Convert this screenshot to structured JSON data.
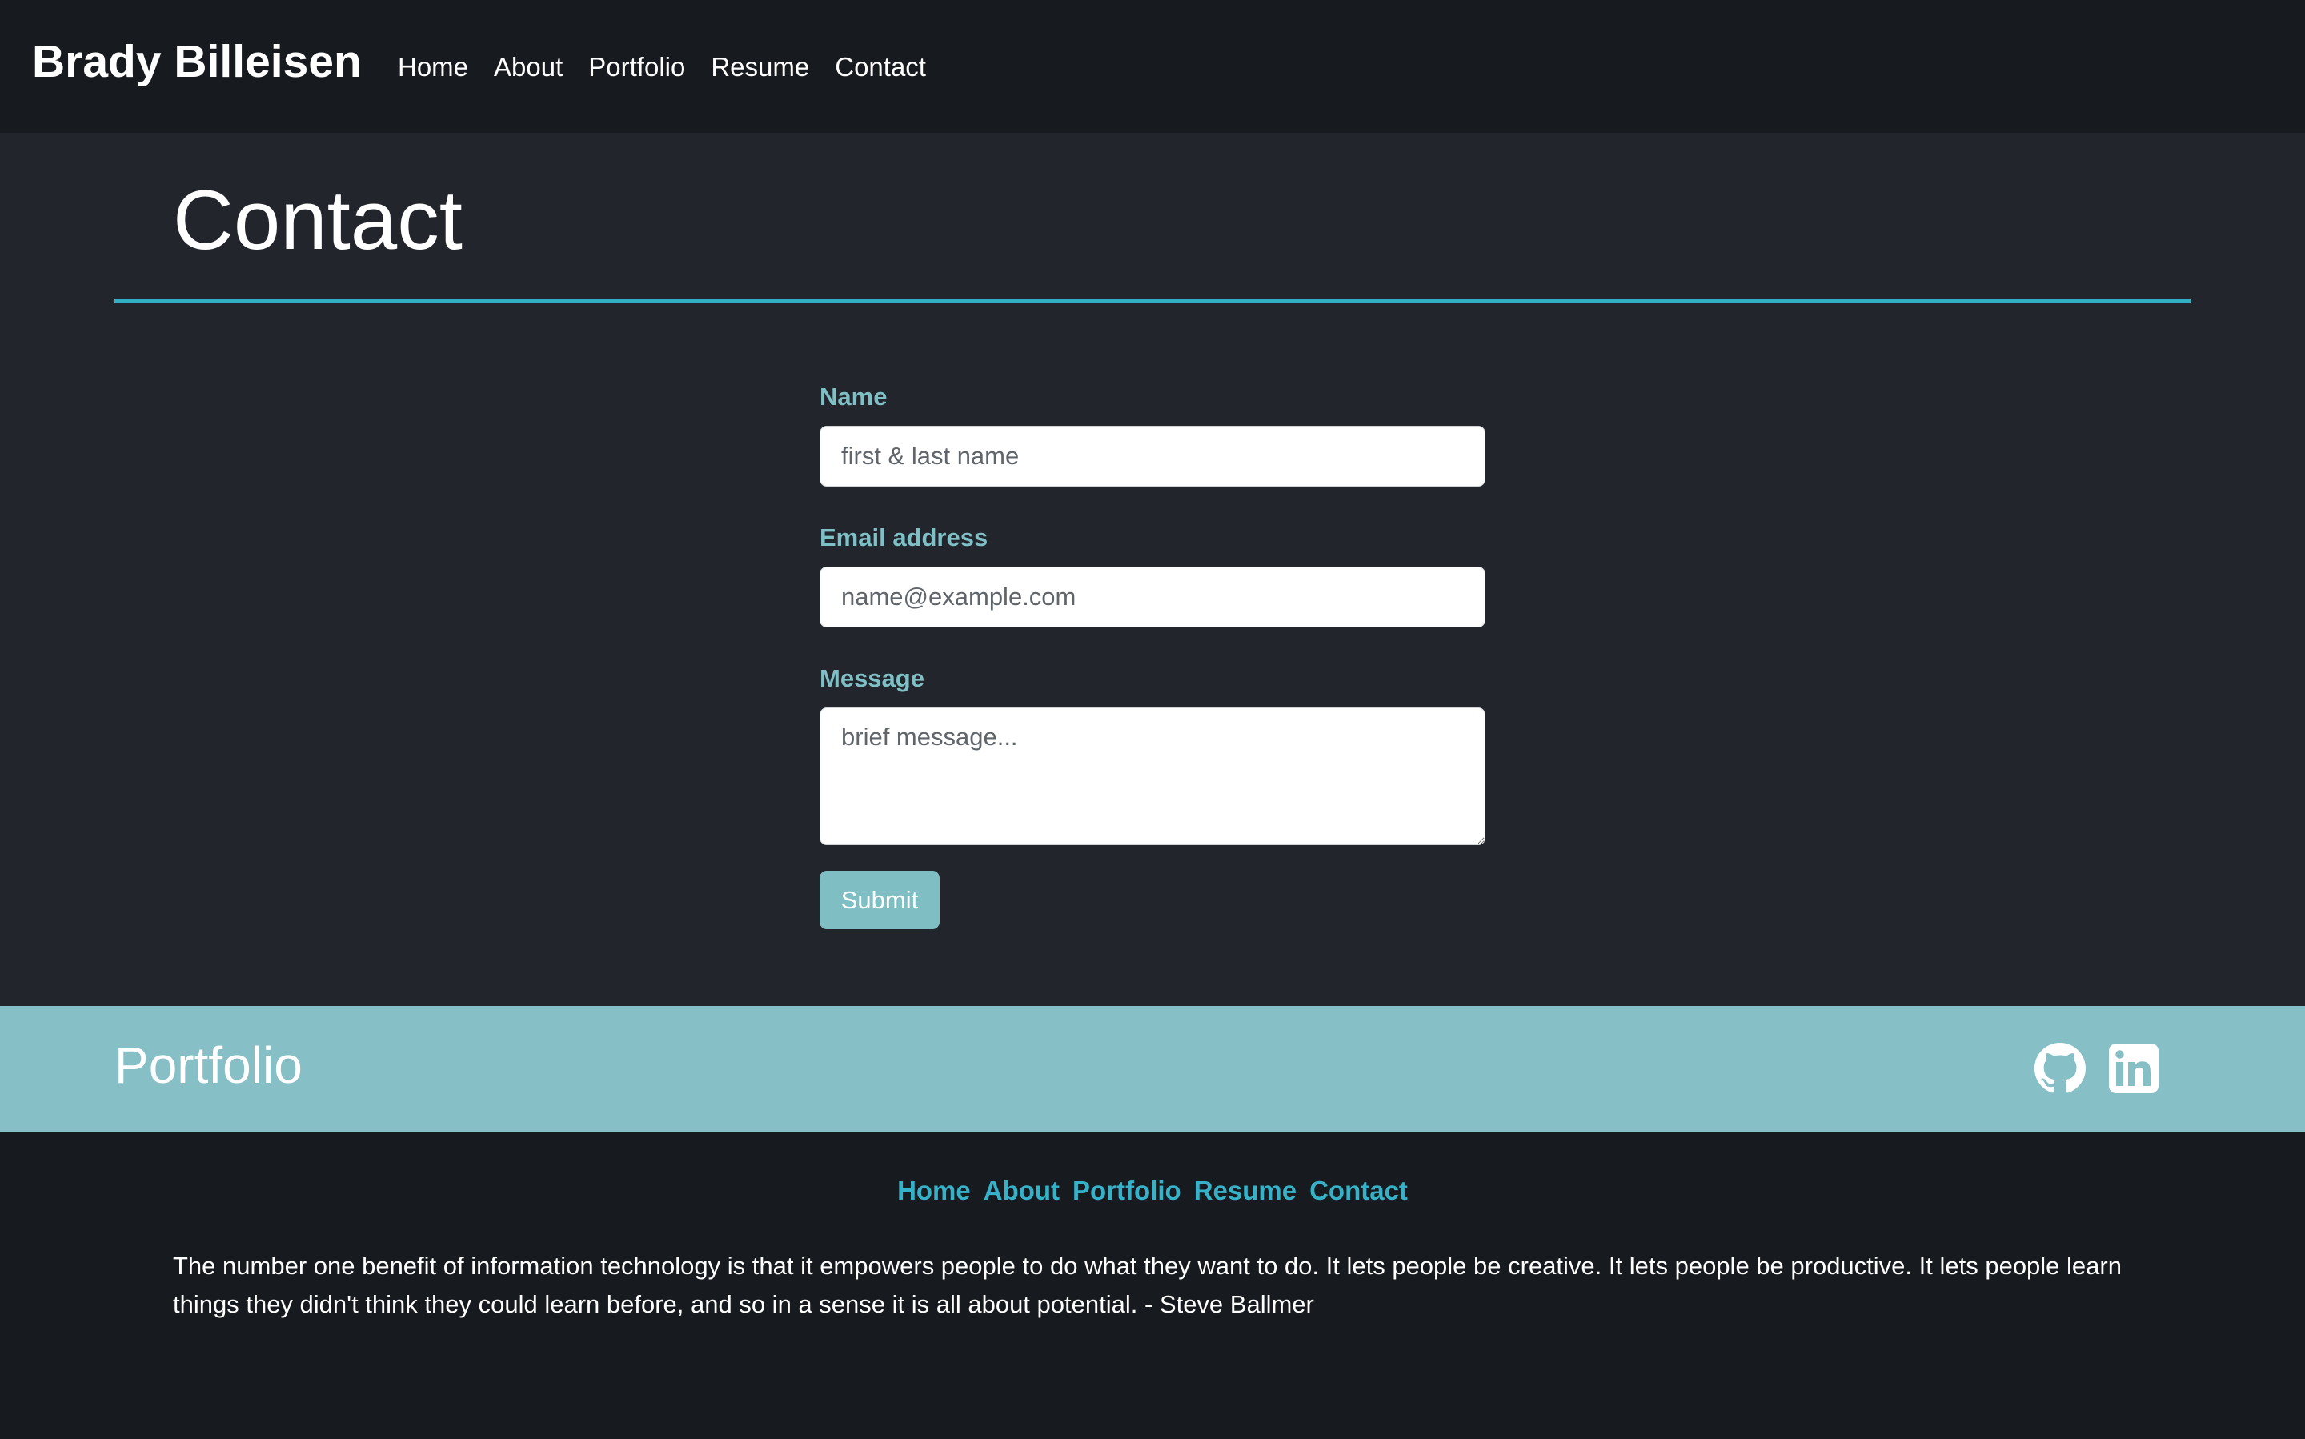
{
  "header": {
    "brand": "Brady Billeisen",
    "nav": [
      {
        "label": "Home"
      },
      {
        "label": "About"
      },
      {
        "label": "Portfolio"
      },
      {
        "label": "Resume"
      },
      {
        "label": "Contact"
      }
    ]
  },
  "main": {
    "title": "Contact",
    "accent_color": "#31b0c4",
    "form": {
      "name_label": "Name",
      "name_placeholder": "first & last name",
      "name_value": "",
      "email_label": "Email address",
      "email_placeholder": "name@example.com",
      "email_value": "",
      "message_label": "Message",
      "message_placeholder": "brief message...",
      "message_value": "",
      "submit_label": "Submit"
    }
  },
  "band": {
    "title": "Portfolio",
    "background": "#86bfc6",
    "icons": [
      "github-icon",
      "linkedin-icon"
    ]
  },
  "footer": {
    "nav": [
      {
        "label": "Home"
      },
      {
        "label": "About"
      },
      {
        "label": "Portfolio"
      },
      {
        "label": "Resume"
      },
      {
        "label": "Contact"
      }
    ],
    "link_color": "#36b1c7",
    "quote": "The number one benefit of information technology is that it empowers people to do what they want to do. It lets people be creative. It lets people be productive. It lets people learn things they didn't think they could learn before, and so in a sense it is all about potential. - Steve Ballmer"
  }
}
